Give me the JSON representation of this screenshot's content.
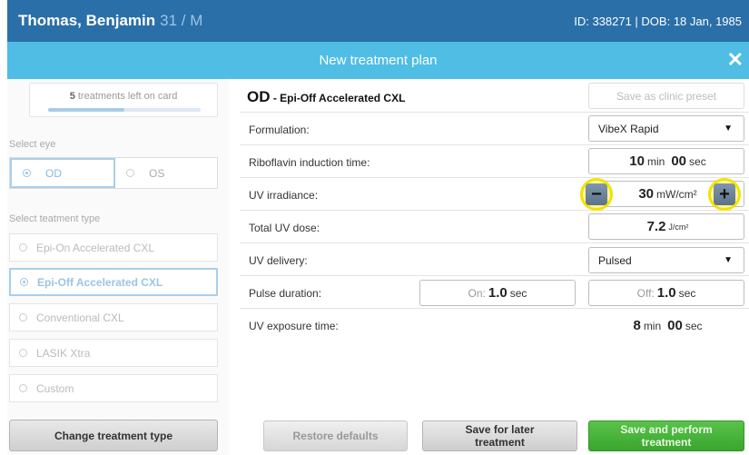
{
  "patient": {
    "name": "Thomas, Benjamin",
    "age_sex": "31 / M",
    "id_dob": "ID: 338271 | DOB: 18 Jan, 1985"
  },
  "dialog": {
    "title": "New treatment plan",
    "close_icon": "close-icon"
  },
  "sidebar": {
    "card_count": "5",
    "card_text": " treatments left on card",
    "card_progress": 0.5,
    "select_eye_label": "Select eye",
    "eyes": [
      {
        "label": "OD",
        "selected": true
      },
      {
        "label": "OS",
        "selected": false
      }
    ],
    "select_type_label": "Select teatment type",
    "types": [
      {
        "label": "Epi-On Accelerated CXL",
        "selected": false
      },
      {
        "label": "Epi-Off Accelerated CXL",
        "selected": true
      },
      {
        "label": "Conventional CXL",
        "selected": false
      },
      {
        "label": "LASIK Xtra",
        "selected": false
      },
      {
        "label": "Custom",
        "selected": false
      }
    ],
    "change_button": "Change treatment type"
  },
  "plan": {
    "eye": "OD",
    "type": " - Epi-Off Accelerated CXL",
    "preset_button": "Save as clinic preset",
    "formulation": {
      "label": "Formulation:",
      "value": "VibeX Rapid"
    },
    "induction": {
      "label": "Riboflavin induction time:",
      "min": "10",
      "min_unit": "min",
      "sec": "00",
      "sec_unit": "sec"
    },
    "irradiance": {
      "label": "UV irradiance:",
      "value": "30",
      "unit": "mW/cm²"
    },
    "dose": {
      "label": "Total UV dose:",
      "value": "7.2",
      "unit": "J/cm²"
    },
    "delivery": {
      "label": "UV delivery:",
      "value": "Pulsed"
    },
    "pulse": {
      "label": "Pulse duration:",
      "on_label": "On:",
      "on_value": "1.0",
      "on_unit": "sec",
      "off_label": "Off:",
      "off_value": "1.0",
      "off_unit": "sec"
    },
    "exposure": {
      "label": "UV exposure time:",
      "min": "8",
      "min_unit": "min",
      "sec": "00",
      "sec_unit": "sec"
    }
  },
  "buttons": {
    "restore": "Restore defaults",
    "save_later_1": "Save for later",
    "save_later_2": "treatment",
    "perform_1": "Save and perform",
    "perform_2": "treatment"
  },
  "icons": {
    "minus": "−",
    "plus": "+",
    "caret": "▼",
    "close": "✕"
  },
  "colors": {
    "header": "#2a6fa8",
    "title_bar": "#4fbde4",
    "highlight": "#f1e200",
    "perform": "#3aa62d"
  }
}
